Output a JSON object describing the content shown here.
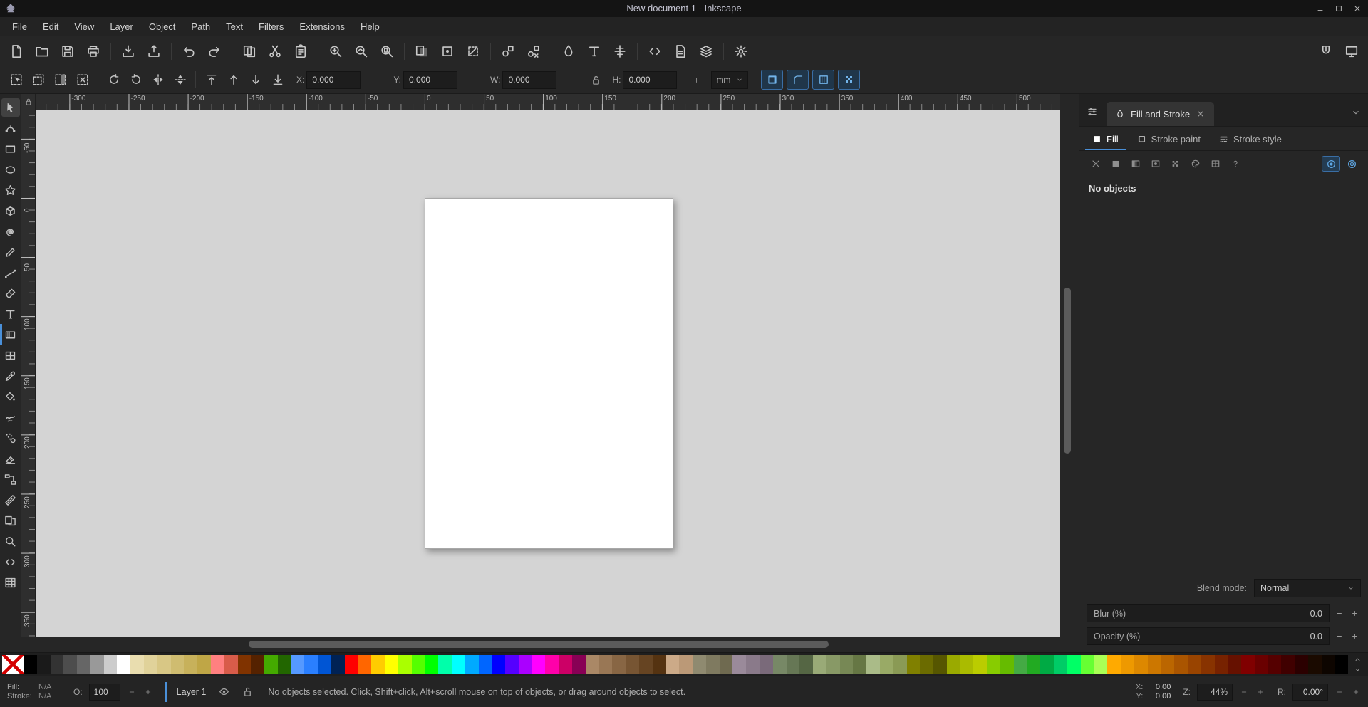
{
  "window": {
    "title": "New document 1 - Inkscape"
  },
  "colors": {
    "accent": "#4a90d9",
    "canvas_bg": "#d4d4d4",
    "page": "#ffffff"
  },
  "menu": [
    "File",
    "Edit",
    "View",
    "Layer",
    "Object",
    "Path",
    "Text",
    "Filters",
    "Extensions",
    "Help"
  ],
  "commandbar": {
    "left": [
      "document-new",
      "document-open",
      "document-save",
      "document-print",
      "document-import",
      "document-export",
      "edit-undo",
      "edit-redo",
      "edit-copy",
      "edit-cut",
      "edit-paste",
      "zoom-selection",
      "zoom-drawing",
      "zoom-page",
      "duplicate",
      "clone",
      "unlink-clone",
      "group",
      "ungroup",
      "fill-stroke-dialog",
      "text-dialog",
      "align-dialog",
      "xml-editor",
      "document-properties",
      "layers-dialog",
      "preferences"
    ],
    "right": [
      "snap-toggle",
      "display-mode"
    ]
  },
  "tool_controls": {
    "icons": [
      "select-all",
      "select-all-layers",
      "select-invert",
      "deselect",
      "rotate-ccw",
      "rotate-cw",
      "flip-horizontal",
      "flip-vertical",
      "raise-to-top",
      "raise",
      "lower",
      "lower-to-bottom"
    ],
    "x_label": "X:",
    "x_value": "0.000",
    "y_label": "Y:",
    "y_value": "0.000",
    "w_label": "W:",
    "w_value": "0.000",
    "h_label": "H:",
    "h_value": "0.000",
    "unit": "mm",
    "toggles": [
      "transform-stroke",
      "transform-corners",
      "transform-gradient",
      "transform-pattern"
    ]
  },
  "toolbox": [
    {
      "tool": "selector",
      "active": true
    },
    {
      "tool": "node"
    },
    {
      "tool": "rectangle"
    },
    {
      "tool": "ellipse"
    },
    {
      "tool": "star"
    },
    {
      "tool": "box-3d"
    },
    {
      "tool": "spiral"
    },
    {
      "tool": "pencil"
    },
    {
      "tool": "pen"
    },
    {
      "tool": "calligraphy"
    },
    {
      "tool": "text"
    },
    {
      "tool": "gradient",
      "highlighted": true
    },
    {
      "tool": "mesh"
    },
    {
      "tool": "dropper"
    },
    {
      "tool": "paint-bucket"
    },
    {
      "tool": "tweak"
    },
    {
      "tool": "spray"
    },
    {
      "tool": "eraser"
    },
    {
      "tool": "connector"
    },
    {
      "tool": "measure"
    },
    {
      "tool": "pages"
    },
    {
      "tool": "zoom"
    },
    {
      "tool": "xml"
    },
    {
      "tool": "swatches"
    }
  ],
  "rulers": {
    "unit": "mm",
    "horizontal": [
      "-300",
      "-250",
      "-200",
      "-150",
      "-100",
      "-50",
      "0",
      "50",
      "100",
      "150",
      "200",
      "250",
      "300",
      "350",
      "400",
      "450",
      "500"
    ],
    "vertical": [
      "-50",
      "0",
      "50",
      "100",
      "150",
      "200",
      "250",
      "300",
      "350"
    ]
  },
  "panel": {
    "title": "Fill and Stroke",
    "tabs": [
      {
        "label": "Fill",
        "icon": "tab-fill",
        "active": true
      },
      {
        "label": "Stroke paint",
        "icon": "tab-stroke-paint",
        "active": false
      },
      {
        "label": "Stroke style",
        "icon": "tab-stroke-style",
        "active": false
      }
    ],
    "paint_buttons": [
      "paint-none",
      "paint-flat",
      "paint-linear",
      "paint-radial",
      "paint-pattern",
      "paint-swatch",
      "paint-mesh",
      "paint-unknown"
    ],
    "fill_rule_buttons": [
      "fill-rule-nonzero",
      "fill-rule-evenodd"
    ],
    "status": "No objects",
    "blend": {
      "label": "Blend mode:",
      "value": "Normal"
    },
    "blur": {
      "label": "Blur (%)",
      "value": "0.0"
    },
    "opacity": {
      "label": "Opacity (%)",
      "value": "0.0"
    }
  },
  "palette": {
    "colors": [
      "#000000",
      "#1a1a1a",
      "#333333",
      "#4d4d4d",
      "#666666",
      "#999999",
      "#cccccc",
      "#ffffff",
      "#e9ddaf",
      "#e0d29a",
      "#d8c785",
      "#cfbc70",
      "#c7b15b",
      "#bfa646",
      "#ff8080",
      "#d85c4a",
      "#803300",
      "#552200",
      "#44aa00",
      "#226600",
      "#5599ff",
      "#2a7fff",
      "#0055d4",
      "#002255",
      "#ff0000",
      "#ff6600",
      "#ffcc00",
      "#ffff00",
      "#aaff00",
      "#55ff00",
      "#00ff00",
      "#00ffaa",
      "#00ffff",
      "#00aaff",
      "#0066ff",
      "#0000ff",
      "#5500ff",
      "#aa00ff",
      "#ff00ff",
      "#ff00aa",
      "#cc0066",
      "#880055",
      "#aa8866",
      "#997755",
      "#886644",
      "#775533",
      "#664422",
      "#553311",
      "#ccaa88",
      "#bb9977",
      "#8f8a70",
      "#7f7a60",
      "#6f6a50",
      "#9a8a9a",
      "#8a7a8a",
      "#7a6a7a",
      "#778866",
      "#667755",
      "#556644",
      "#99aa77",
      "#889966",
      "#778855",
      "#667744",
      "#aabb88",
      "#99aa66",
      "#8a9a55",
      "#808000",
      "#6b6b00",
      "#565600",
      "#9aaa00",
      "#aabb00",
      "#bbcc00",
      "#88cc00",
      "#66bb00",
      "#44aa44",
      "#22aa22",
      "#00aa44",
      "#00cc66",
      "#00ff66",
      "#66ff33",
      "#aaff55",
      "#ffaa00",
      "#ee9900",
      "#dd8800",
      "#cc7700",
      "#bb6600",
      "#aa5500",
      "#994400",
      "#883300",
      "#772200",
      "#661100",
      "#800000",
      "#6a0000",
      "#550000",
      "#400000",
      "#2b0000",
      "#1a0a00",
      "#0d0500",
      "#000000"
    ]
  },
  "statusbar": {
    "fill_label": "Fill:",
    "fill_value": "N/A",
    "stroke_label": "Stroke:",
    "stroke_value": "N/A",
    "opacity_label": "O:",
    "opacity_value": "100",
    "layer_name": "Layer 1",
    "message": "No objects selected. Click, Shift+click, Alt+scroll mouse on top of objects, or drag around objects to select.",
    "x_label": "X:",
    "x_value": "0.00",
    "y_label": "Y:",
    "y_value": "0.00",
    "zoom_label": "Z:",
    "zoom_value": "44%",
    "rotation_label": "R:",
    "rotation_value": "0.00°"
  }
}
